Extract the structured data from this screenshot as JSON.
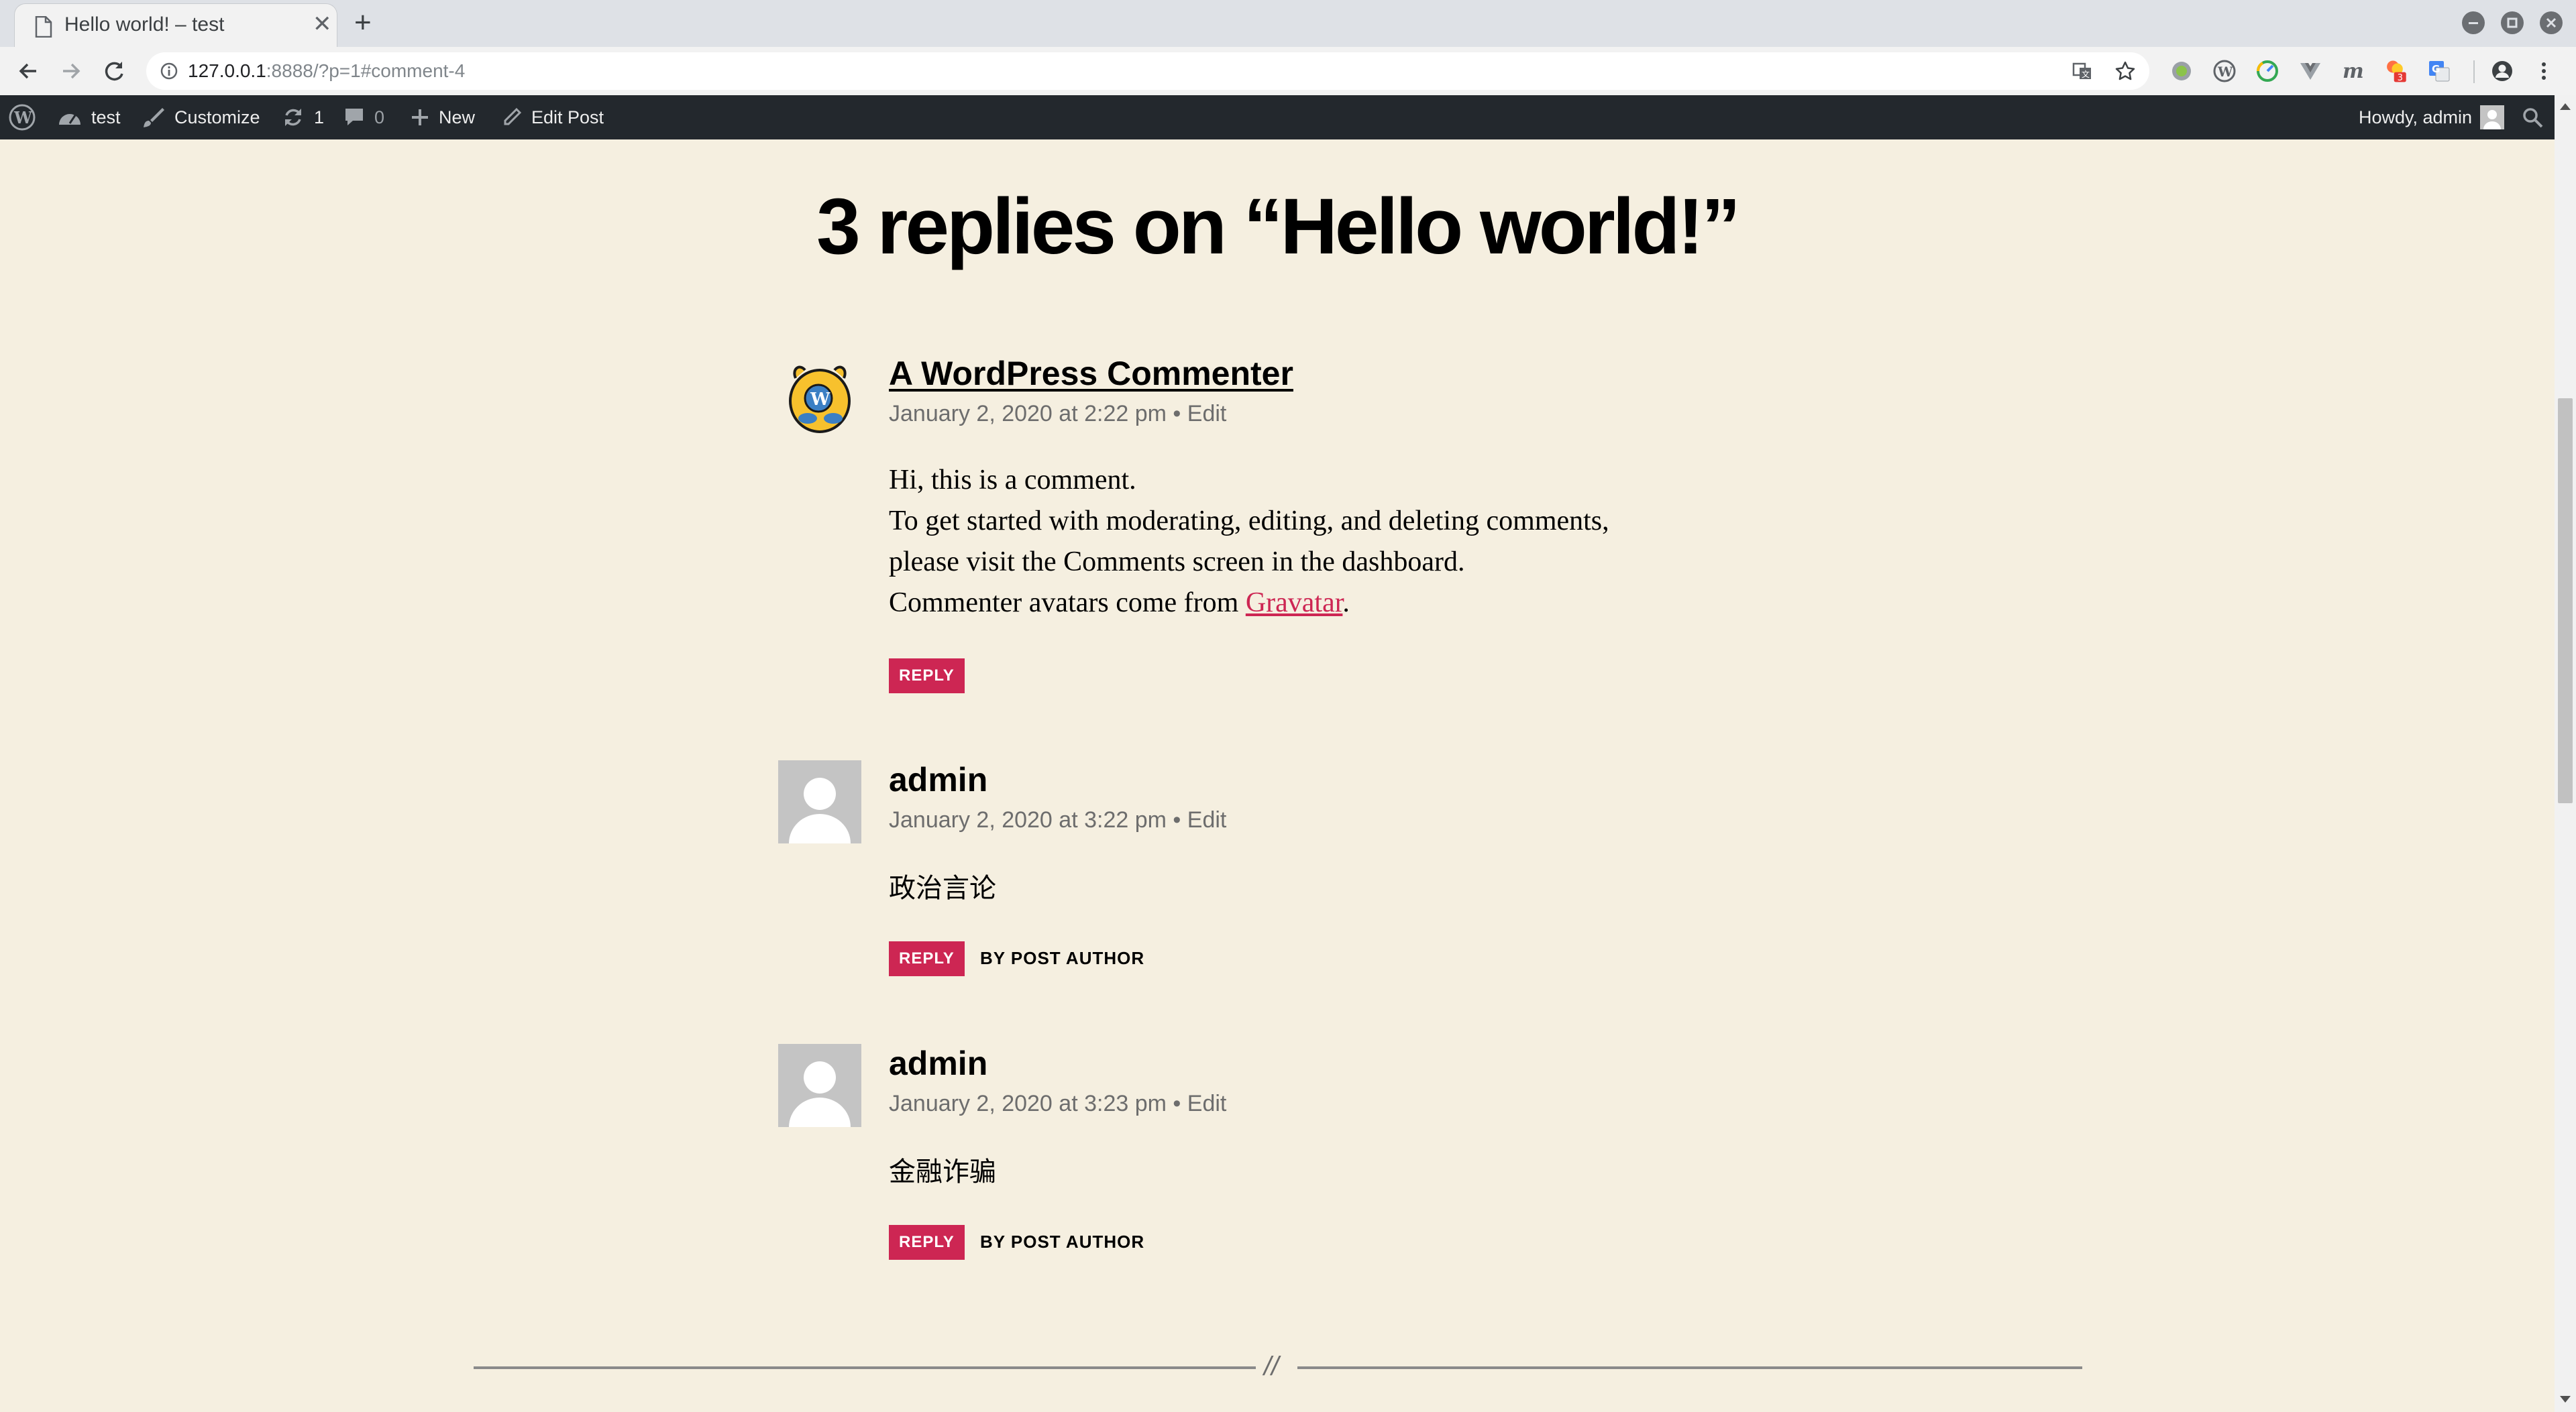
{
  "browser": {
    "tab_title": "Hello world! – test",
    "new_tab_symbol": "+",
    "url_host": "127.0.0.1",
    "url_rest": ":8888/?p=1#comment-4",
    "extension_badge": "3"
  },
  "adminbar": {
    "site_name": "test",
    "customize": "Customize",
    "updates_count": "1",
    "comments_count": "0",
    "new_label": "New",
    "edit_post": "Edit Post",
    "howdy": "Howdy, admin"
  },
  "content": {
    "heading": "3 replies on “Hello world!”",
    "separator_mark": "//",
    "comments": [
      {
        "author": "A WordPress Commenter",
        "avatar": "wapuu-avatar",
        "date": "January 2, 2020 at 2:22 pm",
        "bullet": "•",
        "edit": "Edit",
        "lines": [
          "Hi, this is a comment.",
          "To get started with moderating, editing, and deleting comments,",
          "please visit the Comments screen in the dashboard."
        ],
        "gravatar_prefix": "Commenter avatars come from ",
        "gravatar_link": "Gravatar",
        "gravatar_suffix": ".",
        "reply": "REPLY"
      },
      {
        "author": "admin",
        "avatar": "default-avatar",
        "date": "January 2, 2020 at 3:22 pm",
        "bullet": "•",
        "edit": "Edit",
        "text": "政治言论",
        "reply": "REPLY",
        "byline": "BY POST AUTHOR"
      },
      {
        "author": "admin",
        "avatar": "default-avatar",
        "date": "January 2, 2020 at 3:23 pm",
        "bullet": "•",
        "edit": "Edit",
        "text": "金融诈骗",
        "reply": "REPLY",
        "byline": "BY POST AUTHOR"
      }
    ]
  },
  "colors": {
    "page_bg": "#f5efe0",
    "accent": "#cd2653",
    "adminbar_bg": "#23282d"
  }
}
